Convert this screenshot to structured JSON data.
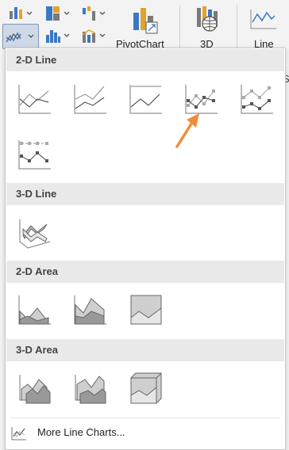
{
  "ribbon": {
    "pivotchart_label": "PivotChart",
    "map3d_label": "3D",
    "line_label": "Line",
    "edge_letter": "S"
  },
  "menu": {
    "sections": {
      "line2d": "2-D Line",
      "line3d": "3-D Line",
      "area2d": "2-D Area",
      "area3d": "3-D Area"
    },
    "more_label": "More Line Charts..."
  },
  "colors": {
    "accent_arrow": "#f08c3a",
    "section_bg": "#e9e9e9",
    "selected_btn": "#cfd8e6"
  }
}
